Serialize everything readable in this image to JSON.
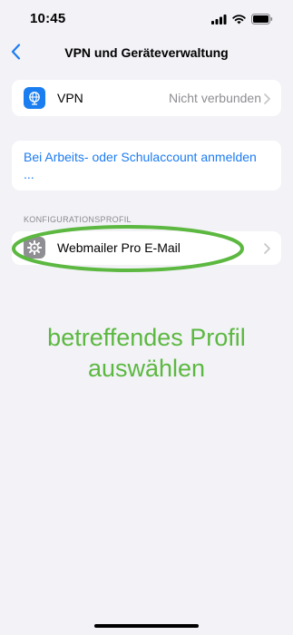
{
  "status_bar": {
    "time": "10:45"
  },
  "nav": {
    "title": "VPN und Geräteverwaltung"
  },
  "vpn_row": {
    "label": "VPN",
    "value": "Nicht verbunden"
  },
  "account_row": {
    "link": "Bei Arbeits- oder Schulaccount anmelden ..."
  },
  "config_section": {
    "header": "KONFIGURATIONSPROFIL"
  },
  "profile_row": {
    "label": "Webmailer Pro E-Mail"
  },
  "annotation": {
    "text": "betreffendes Profil auswählen"
  },
  "colors": {
    "background": "#f2f2f7",
    "link": "#1d7cf2",
    "annotation": "#5cb840",
    "vpn_icon": "#1a7ef0",
    "profile_icon": "#8e8e93"
  },
  "icons": [
    "cellular-signal-icon",
    "wifi-icon",
    "battery-icon",
    "chevron-left-icon",
    "vpn-globe-icon",
    "gear-icon",
    "chevron-right-icon"
  ]
}
